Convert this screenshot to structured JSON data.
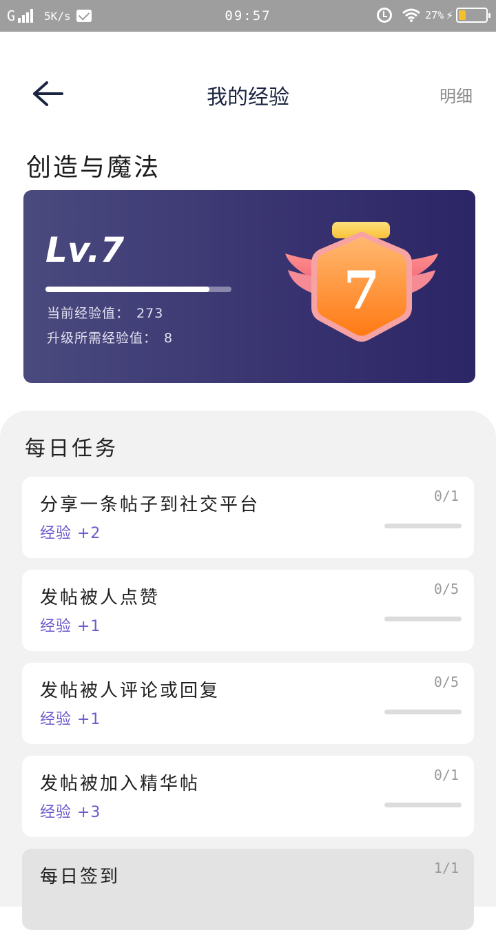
{
  "status_bar": {
    "carrier": "G",
    "net_speed": "5K/s",
    "time": "09:57",
    "battery_pct": "27%",
    "battery_level": 0.27
  },
  "header": {
    "title": "我的经验",
    "detail_label": "明细"
  },
  "forum": {
    "name": "创造与魔法"
  },
  "level": {
    "label": "Lv.7",
    "number": "7",
    "progress_fraction": 0.88,
    "current_exp_label": "当前经验值：",
    "current_exp_value": "273",
    "needed_exp_label": "升级所需经验值：",
    "needed_exp_value": "8"
  },
  "tasks": {
    "title": "每日任务",
    "items": [
      {
        "name": "分享一条帖子到社交平台",
        "reward": "经验 +2",
        "count": "0/1",
        "progress": 0
      },
      {
        "name": "发帖被人点赞",
        "reward": "经验 +1",
        "count": "0/5",
        "progress": 0
      },
      {
        "name": "发帖被人评论或回复",
        "reward": "经验 +1",
        "count": "0/5",
        "progress": 0
      },
      {
        "name": "发帖被加入精华帖",
        "reward": "经验 +3",
        "count": "0/1",
        "progress": 0
      },
      {
        "name": "每日签到",
        "reward": "",
        "count": "1/1",
        "progress": 1
      }
    ]
  },
  "colors": {
    "accent": "#6a5acd",
    "card_gradient_start": "#4a4a7e",
    "card_gradient_end": "#2c2566",
    "medal_orange": "#ff8a1f"
  }
}
